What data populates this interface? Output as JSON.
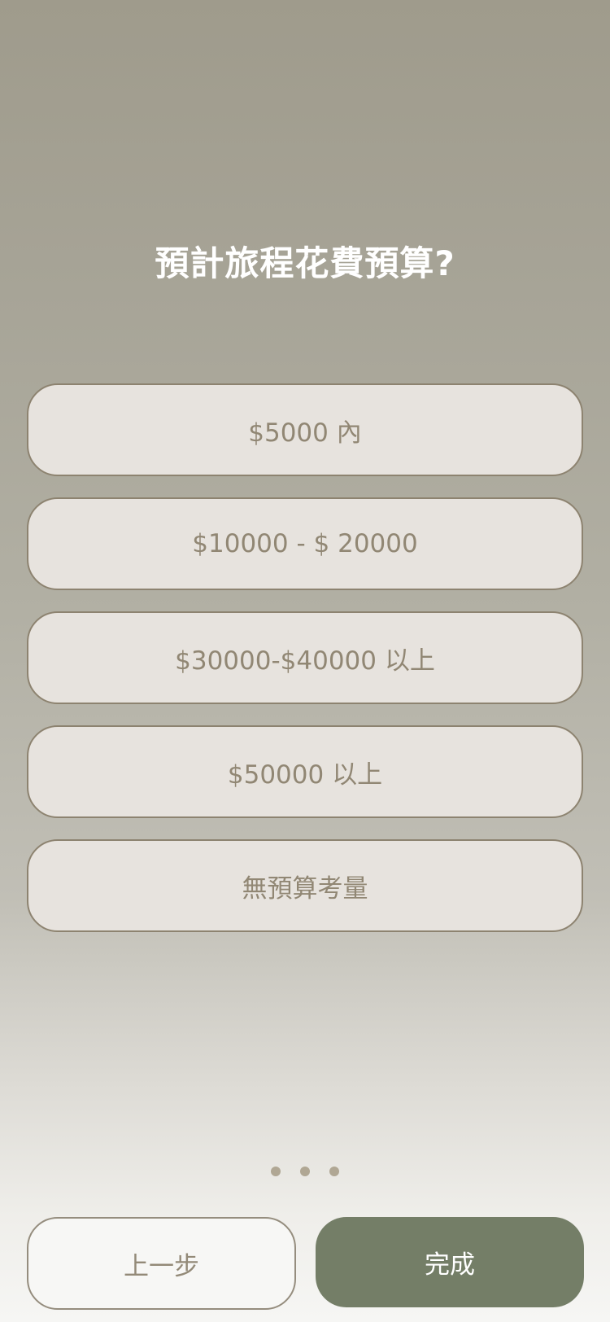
{
  "question": {
    "title": "預計旅程花費預算?"
  },
  "options": [
    {
      "label": "$5000 內"
    },
    {
      "label": "$10000 - $ 20000"
    },
    {
      "label": "$30000-$40000 以上"
    },
    {
      "label": "$50000 以上"
    },
    {
      "label": "無預算考量"
    }
  ],
  "pagination": {
    "total_dots": 3
  },
  "actions": {
    "back_label": "上一步",
    "done_label": "完成"
  },
  "colors": {
    "accent": "#747e67",
    "option_bg": "#e7e3de",
    "option_border": "#8d8370",
    "option_text": "#918774"
  }
}
